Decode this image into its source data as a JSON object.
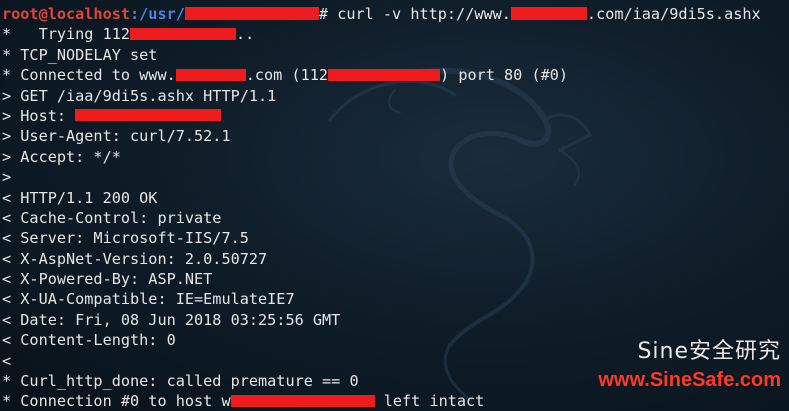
{
  "prompt": {
    "user_host": "root@localhost",
    "path_prefix": ":/usr/",
    "suffix": "# ",
    "command": "curl -v http://www.",
    "command_tail": ".com/iaa/9di5s.ashx"
  },
  "lines": [
    {
      "a": "*   Trying 112",
      "b": ".."
    },
    {
      "a": "* TCP_NODELAY set"
    },
    {
      "a": "* Connected to www.",
      "b": ".com (112",
      "c": ") port 80 (#0)"
    },
    {
      "a": "> GET /iaa/9di5s.ashx HTTP/1.1"
    },
    {
      "a": "> Host: "
    },
    {
      "a": "> User-Agent: curl/7.52.1"
    },
    {
      "a": "> Accept: */*"
    },
    {
      "a": ">"
    },
    {
      "a": "< HTTP/1.1 200 OK"
    },
    {
      "a": "< Cache-Control: private"
    },
    {
      "a": "< Server: Microsoft-IIS/7.5"
    },
    {
      "a": "< X-AspNet-Version: 2.0.50727"
    },
    {
      "a": "< X-Powered-By: ASP.NET"
    },
    {
      "a": "< X-UA-Compatible: IE=EmulateIE7"
    },
    {
      "a": "< Date: Fri, 08 Jun 2018 03:25:56 GMT"
    },
    {
      "a": "< Content-Length: 0"
    },
    {
      "a": "<"
    },
    {
      "a": "* Curl_http_done: called premature == 0"
    },
    {
      "a": "* Connection #0 to host w",
      "b": " left intact"
    }
  ],
  "watermark": {
    "brand": "Sine安全研究",
    "url": "www.SineSafe.com"
  },
  "colors": {
    "prompt_user": "#e0463d",
    "prompt_path": "#4f7fe0",
    "text": "#e6e6e6",
    "redaction": "#ee1c1c",
    "watermark_url": "#ff3b1f",
    "background": "#0f1d29"
  },
  "icons": {
    "background_art": "kali-dragon-icon"
  }
}
